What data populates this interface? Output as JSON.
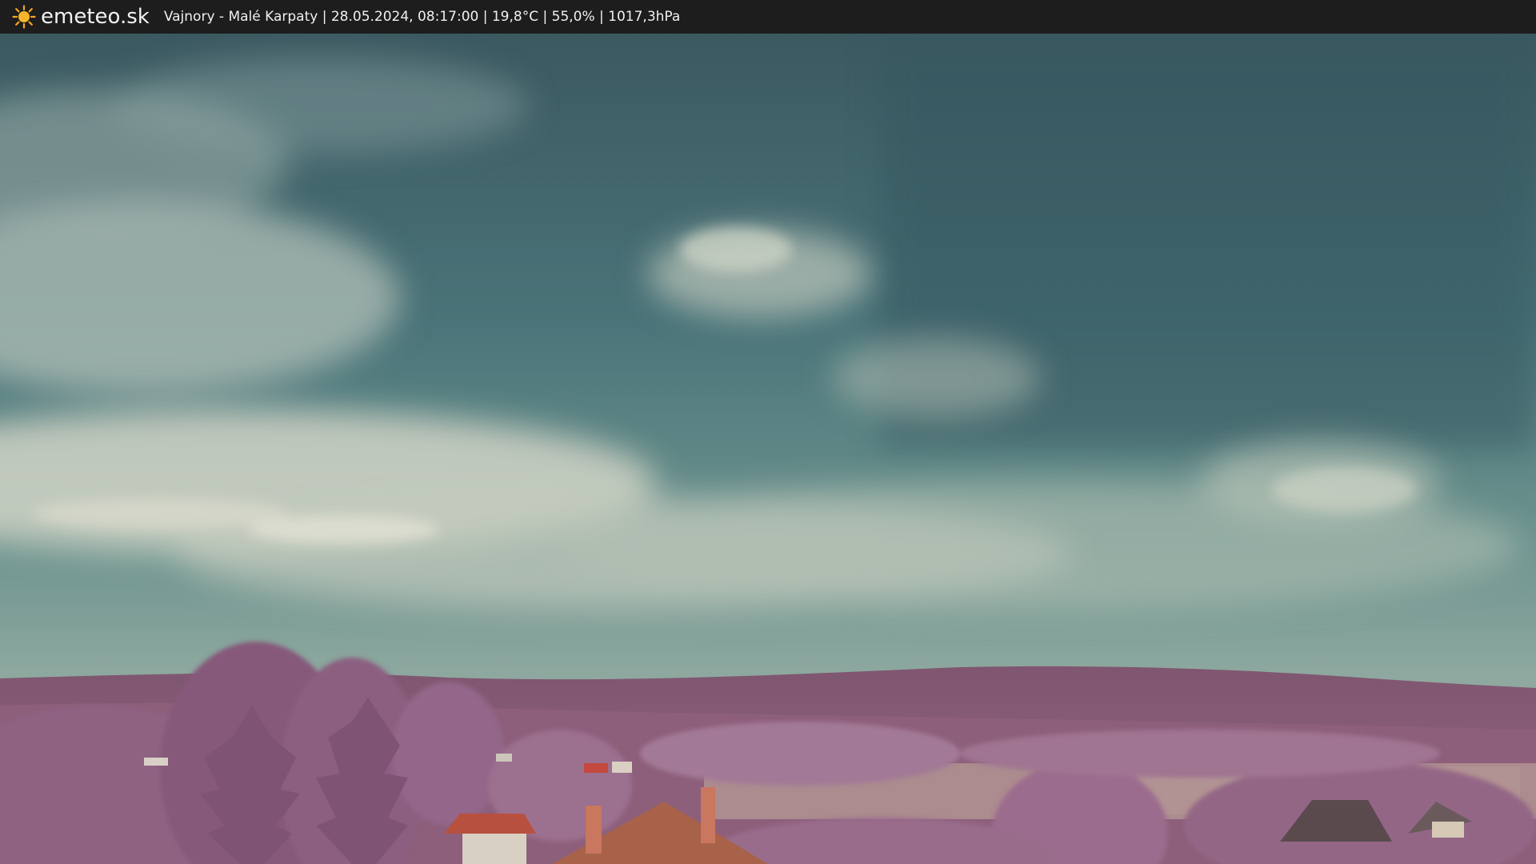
{
  "header": {
    "brand": "emeteo.sk",
    "caption": "Vajnory - Malé Karpaty | 28.05.2024, 08:17:00 | 19,8°C | 55,0% | 1017,3hPa",
    "icon": "sun-icon"
  },
  "colors": {
    "bar": "#1d1d1d",
    "sun": "#f5a623",
    "sky_top": "#3f5f66",
    "sky_mid": "#4f7f84",
    "haze": "#9db2a8",
    "hills": "#8a5c74",
    "trees": "#9a6a88",
    "roof": "#b0503e"
  }
}
